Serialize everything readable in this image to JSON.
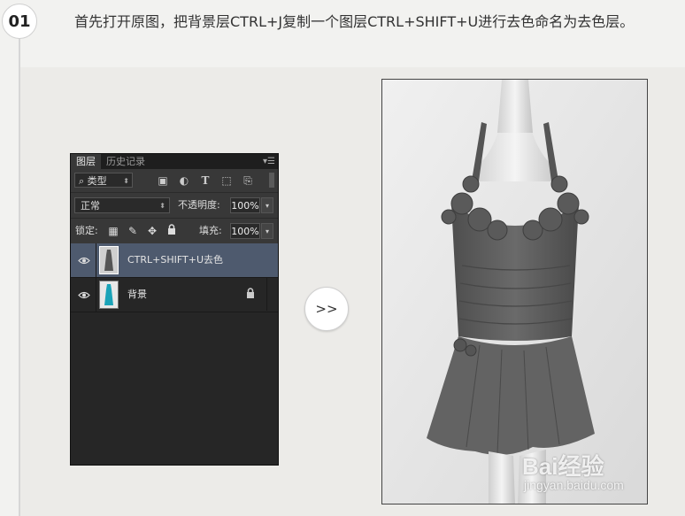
{
  "step": {
    "number": "01",
    "text": "首先打开原图，把背景层CTRL+J复制一个图层CTRL+SHIFT+U进行去色命名为去色层。"
  },
  "ps_panel": {
    "tabs": [
      "图层",
      "历史记录"
    ],
    "active_tab": 0,
    "filter_kind": "类型",
    "blend_mode": "正常",
    "opacity_label": "不透明度:",
    "opacity_value": "100%",
    "lock_label": "锁定:",
    "fill_label": "填充:",
    "fill_value": "100%",
    "layers": [
      {
        "name": "CTRL+SHIFT+U去色",
        "visible": true,
        "selected": true,
        "locked": false,
        "thumb": "grayscale-dress"
      },
      {
        "name": "背景",
        "visible": true,
        "selected": false,
        "locked": true,
        "thumb": "teal-dress"
      }
    ]
  },
  "next_button": ">>",
  "watermark": {
    "logo": "Bai经验",
    "site": "jingyan.baidu.com"
  },
  "colors": {
    "panel_bg": "#262626",
    "panel_header": "#383838",
    "selected_layer": "#4e5a6e",
    "teal_dress": "#1aa3b8"
  }
}
